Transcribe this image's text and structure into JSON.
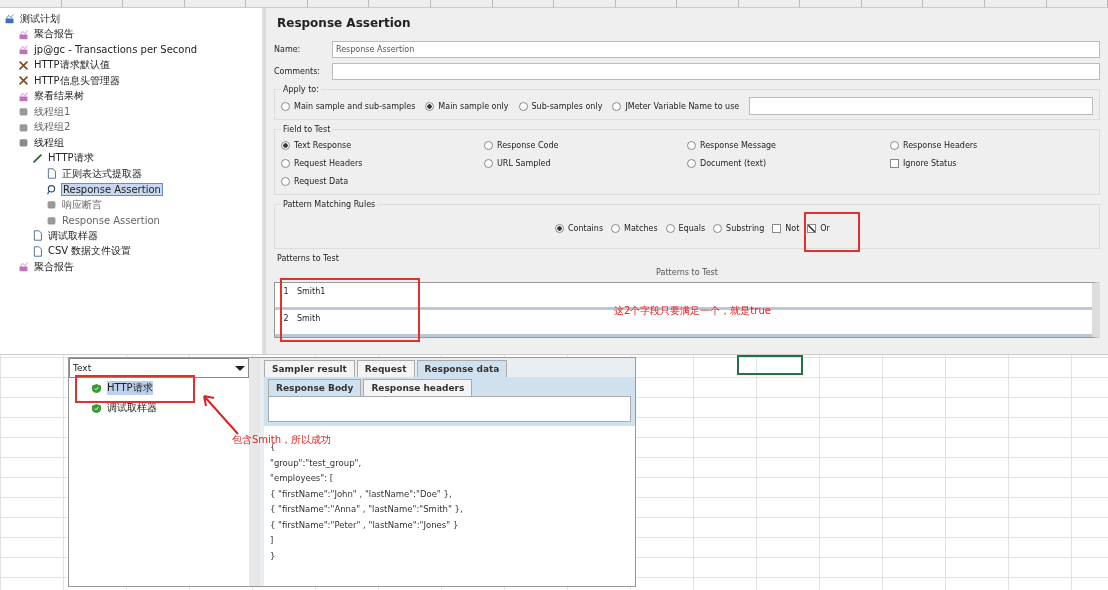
{
  "tree": [
    {
      "label": "测试计划",
      "kind": "plan",
      "disabled": false,
      "selected": false,
      "children": [
        {
          "label": "聚合报告",
          "kind": "report",
          "disabled": false,
          "selected": false
        },
        {
          "label": "jp@gc - Transactions per Second",
          "kind": "report",
          "disabled": false,
          "selected": false
        },
        {
          "label": "HTTP请求默认值",
          "kind": "config",
          "disabled": false,
          "selected": false
        },
        {
          "label": "HTTP信息头管理器",
          "kind": "config",
          "disabled": false,
          "selected": false
        },
        {
          "label": "察看结果树",
          "kind": "report",
          "disabled": false,
          "selected": false
        },
        {
          "label": "线程组1",
          "kind": "threads",
          "disabled": true,
          "selected": false
        },
        {
          "label": "线程组2",
          "kind": "threads",
          "disabled": true,
          "selected": false
        },
        {
          "label": "线程组",
          "kind": "threads",
          "disabled": false,
          "selected": false,
          "children": [
            {
              "label": "HTTP请求",
              "kind": "sampler",
              "disabled": false,
              "selected": false,
              "children": [
                {
                  "label": "正则表达式提取器",
                  "kind": "extractor",
                  "disabled": false,
                  "selected": false
                },
                {
                  "label": "Response Assertion",
                  "kind": "assertion",
                  "disabled": false,
                  "selected": true
                },
                {
                  "label": "响应断言",
                  "kind": "threads",
                  "disabled": true,
                  "selected": false
                },
                {
                  "label": "Response Assertion",
                  "kind": "threads",
                  "disabled": true,
                  "selected": false
                }
              ]
            },
            {
              "label": "调试取样器",
              "kind": "extractor",
              "disabled": false,
              "selected": false
            },
            {
              "label": "CSV 数据文件设置",
              "kind": "extractor",
              "disabled": false,
              "selected": false
            }
          ]
        },
        {
          "label": "聚合报告",
          "kind": "report",
          "disabled": false,
          "selected": false
        }
      ]
    }
  ],
  "panel": {
    "title": "Response Assertion",
    "name_label": "Name:",
    "name_value": "Response Assertion",
    "comments_label": "Comments:",
    "apply_to": {
      "legend": "Apply to:",
      "options": [
        {
          "label": "Main sample and sub-samples",
          "selected": false
        },
        {
          "label": "Main sample only",
          "selected": true
        },
        {
          "label": "Sub-samples only",
          "selected": false
        },
        {
          "label": "JMeter Variable Name to use",
          "selected": false
        }
      ]
    },
    "field_to_test": {
      "legend": "Field to Test",
      "options": [
        {
          "kind": "radio",
          "label": "Text Response",
          "selected": true
        },
        {
          "kind": "radio",
          "label": "Response Code",
          "selected": false
        },
        {
          "kind": "radio",
          "label": "Response Message",
          "selected": false
        },
        {
          "kind": "radio",
          "label": "Response Headers",
          "selected": false
        },
        {
          "kind": "radio",
          "label": "Request Headers",
          "selected": false
        },
        {
          "kind": "radio",
          "label": "URL Sampled",
          "selected": false
        },
        {
          "kind": "radio",
          "label": "Document (text)",
          "selected": false
        },
        {
          "kind": "checkbox",
          "label": "Ignore Status",
          "selected": false
        },
        {
          "kind": "radio",
          "label": "Request Data",
          "selected": false
        }
      ]
    },
    "matching": {
      "legend": "Pattern Matching Rules",
      "options": [
        {
          "kind": "radio",
          "label": "Contains",
          "selected": true
        },
        {
          "kind": "radio",
          "label": "Matches",
          "selected": false
        },
        {
          "kind": "radio",
          "label": "Equals",
          "selected": false
        },
        {
          "kind": "radio",
          "label": "Substring",
          "selected": false
        },
        {
          "kind": "checkbox",
          "label": "Not",
          "selected": false
        },
        {
          "kind": "checkbox",
          "label": "Or",
          "selected": true
        }
      ]
    },
    "patterns": {
      "legend": "Patterns to Test",
      "header": "Patterns to Test",
      "rows": [
        {
          "num": "1",
          "value": "Smith1"
        },
        {
          "num": "2",
          "value": "Smith"
        }
      ]
    }
  },
  "notes": [
    {
      "text": "这2个字段只要满足一个，就是true"
    },
    {
      "text": "包含Smith，所以成功"
    }
  ],
  "results": {
    "renderer": "Text",
    "items": [
      {
        "label": "HTTP请求",
        "selected": true
      },
      {
        "label": "调试取样器",
        "selected": false
      }
    ],
    "tabs": [
      {
        "label": "Sampler result",
        "selected": false
      },
      {
        "label": "Request",
        "selected": false
      },
      {
        "label": "Response data",
        "selected": true
      }
    ],
    "subtabs": [
      {
        "label": "Response Body",
        "selected": true
      },
      {
        "label": "Response headers",
        "selected": false
      }
    ],
    "body": [
      "{",
      "\"group\":\"test_group\",",
      "\"employees\": [",
      "{ \"firstName\":\"John\" , \"lastName\":\"Doe\" },",
      "{ \"firstName\":\"Anna\" , \"lastName\":\"Smith\" },",
      "{ \"firstName\":\"Peter\" , \"lastName\":\"Jones\" }",
      "]",
      "}"
    ]
  }
}
